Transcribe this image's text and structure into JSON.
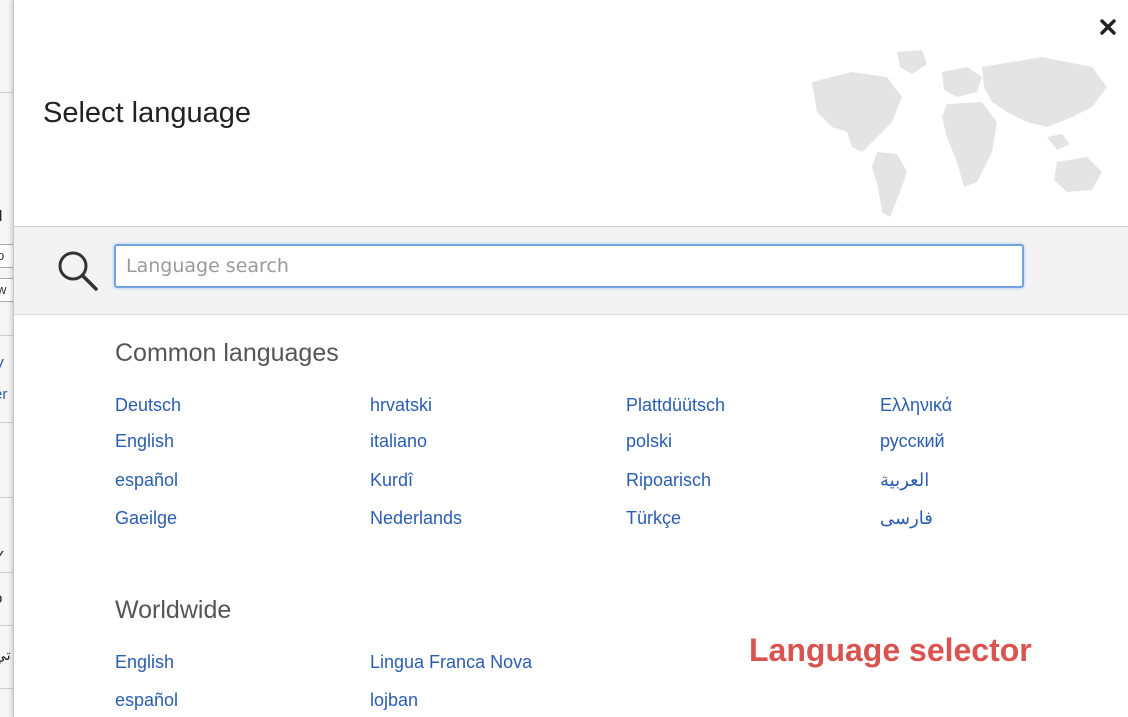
{
  "background": {
    "fragments": [
      ")",
      "d",
      "o",
      "w",
      "V",
      "er",
      "Y",
      "o",
      "تي"
    ]
  },
  "dialog": {
    "title": "Select language",
    "close_label": "×"
  },
  "search": {
    "placeholder": "Language search",
    "value": ""
  },
  "common": {
    "heading": "Common languages",
    "columns": [
      [
        "Deutsch",
        "English",
        "español",
        "Gaeilge"
      ],
      [
        "hrvatski",
        "italiano",
        "Kurdî",
        "Nederlands"
      ],
      [
        "Plattdüütsch",
        "polski",
        "Ripoarisch",
        "Türkçe"
      ],
      [
        "Ελληνικά",
        "русский",
        "العربية",
        "فارسی"
      ]
    ]
  },
  "worldwide": {
    "heading": "Worldwide",
    "columns": [
      [
        "English",
        "español"
      ],
      [
        "Lingua Franca Nova",
        "lojban"
      ]
    ]
  },
  "annotation": "Language selector",
  "colors": {
    "link": "#2a5db0",
    "annotation": "#d9534f",
    "focus_border": "#74a2e0"
  }
}
